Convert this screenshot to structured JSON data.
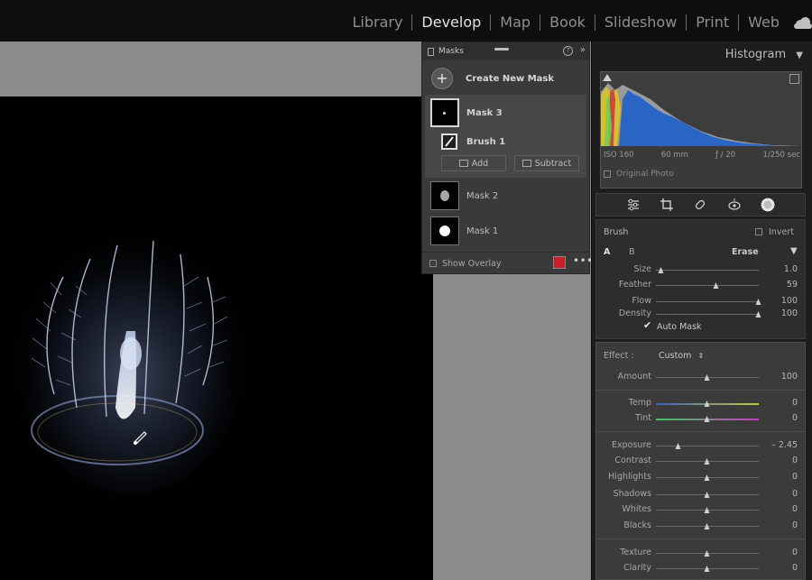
{
  "modules": [
    "Library",
    "Develop",
    "Map",
    "Book",
    "Slideshow",
    "Print",
    "Web"
  ],
  "active_module": "Develop",
  "masks_panel": {
    "title": "Masks",
    "create_label": "Create New Mask",
    "masks": [
      "Mask 3",
      "Mask 2",
      "Mask 1"
    ],
    "brush_component": "Brush 1",
    "add_label": "Add",
    "subtract_label": "Subtract",
    "overlay_label": "Show Overlay",
    "overlay_color": "#c8202a"
  },
  "histogram": {
    "title": "Histogram",
    "iso": "ISO 160",
    "focal": "60 mm",
    "aperture": "ƒ / 20",
    "shutter": "1/250 sec",
    "original_label": "Original Photo"
  },
  "brush": {
    "title": "Brush",
    "invert_label": "Invert",
    "tab_a": "A",
    "tab_b": "B",
    "erase_label": "Erase",
    "size_label": "Size",
    "size_value": "1.0",
    "size_pos": 0.05,
    "feather_label": "Feather",
    "feather_value": "59",
    "feather_pos": 0.59,
    "flow_label": "Flow",
    "flow_value": "100",
    "flow_pos": 1.0,
    "density_label": "Density",
    "density_value": "100",
    "density_pos": 1.0,
    "automask_label": "Auto Mask",
    "automask_checked": true
  },
  "effect": {
    "label": "Effect :",
    "preset": "Custom",
    "sliders": [
      {
        "name": "Amount",
        "value": "100",
        "pos": 0.5
      },
      {
        "name": "Temp",
        "value": "0",
        "pos": 0.5
      },
      {
        "name": "Tint",
        "value": "0",
        "pos": 0.5
      },
      {
        "name": "Exposure",
        "value": "– 2.45",
        "pos": 0.22
      },
      {
        "name": "Contrast",
        "value": "0",
        "pos": 0.5
      },
      {
        "name": "Highlights",
        "value": "0",
        "pos": 0.5
      },
      {
        "name": "Shadows",
        "value": "0",
        "pos": 0.5
      },
      {
        "name": "Whites",
        "value": "0",
        "pos": 0.5
      },
      {
        "name": "Blacks",
        "value": "0",
        "pos": 0.5
      },
      {
        "name": "Texture",
        "value": "0",
        "pos": 0.5
      },
      {
        "name": "Clarity",
        "value": "0",
        "pos": 0.5
      }
    ]
  }
}
